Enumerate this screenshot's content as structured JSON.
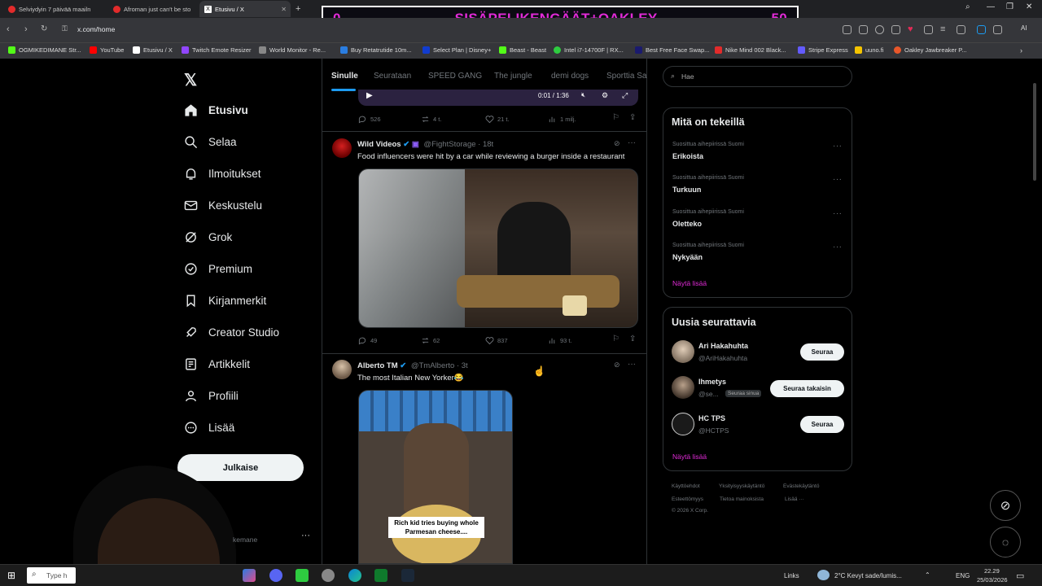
{
  "browser": {
    "tabs": [
      {
        "label": "Selviydyin 7 päivää maailn",
        "color": "#e22b2b"
      },
      {
        "label": "Afroman just can't be sto",
        "color": "#e22b2b"
      },
      {
        "label": "Etusivu / X",
        "color": "#ffffff",
        "active": true
      }
    ],
    "new_tab": "+",
    "url": "x.com/home"
  },
  "overlay": {
    "left_count": "0",
    "title": "SISÄPELIKENGÄÄT+OAKLEY",
    "right_count": "50"
  },
  "bookmarks": [
    {
      "label": "OGMIKEDIMANE Str...",
      "color": "#53fc18"
    },
    {
      "label": "YouTube",
      "color": "#ff0000"
    },
    {
      "label": "Etusivu / X",
      "color": "#ffffff"
    },
    {
      "label": "Twitch Emote Resizer",
      "color": "#9146ff"
    },
    {
      "label": "World Monitor - Re...",
      "color": "#888888"
    },
    {
      "label": "Buy Retatrutide 10m...",
      "color": "#2a7de1"
    },
    {
      "label": "Select Plan | Disney+",
      "color": "#113ccf"
    },
    {
      "label": "Beast - Beast",
      "color": "#53fc18"
    },
    {
      "label": "Intel i7-14700F | RX...",
      "color": "#2ecc40"
    },
    {
      "label": "Best Free Face Swap...",
      "color": "#1a1a6e"
    },
    {
      "label": "Nike Mind 002 Black...",
      "color": "#e22b2b"
    },
    {
      "label": "Stripe Express",
      "color": "#635bff"
    },
    {
      "label": "uuno.fi",
      "color": "#f5c400"
    },
    {
      "label": "Oakley Jawbreaker P...",
      "color": "#e8572a"
    }
  ],
  "sidebar": {
    "items": [
      {
        "label": "Etusivu",
        "icon": "home-icon",
        "bold": true
      },
      {
        "label": "Selaa",
        "icon": "search-icon"
      },
      {
        "label": "Ilmoitukset",
        "icon": "bell-icon"
      },
      {
        "label": "Keskustelu",
        "icon": "mail-icon"
      },
      {
        "label": "Grok",
        "icon": "grok-icon"
      },
      {
        "label": "Premium",
        "icon": "verified-icon"
      },
      {
        "label": "Kirjanmerkit",
        "icon": "bookmark-icon"
      },
      {
        "label": "Creator Studio",
        "icon": "rocket-icon"
      },
      {
        "label": "Artikkelit",
        "icon": "article-icon"
      },
      {
        "label": "Profiili",
        "icon": "person-icon"
      },
      {
        "label": "Lisää",
        "icon": "more-circle-icon"
      }
    ],
    "post_button": "Julkaise",
    "account_handle_fragment": "kemane"
  },
  "feed": {
    "tabs": [
      "Sinulle",
      "Seurataan",
      "SPEED GANG",
      "The jungle",
      "demi dogs",
      "Sporttia Sa"
    ],
    "video_time": "0:01 / 1:36",
    "top_stats": {
      "replies": "526",
      "reposts": "4 t.",
      "likes": "21 t.",
      "views": "1 milj."
    },
    "tweets": [
      {
        "author": "Wild Videos",
        "handle": "@FightStorage · 18t",
        "text": "Food influencers were hit by a car while reviewing a burger inside a restaurant",
        "stats": {
          "replies": "49",
          "reposts": "62",
          "likes": "837",
          "views": "93 t."
        }
      },
      {
        "author": "Alberto TM",
        "handle": "@TmAlberto · 3t",
        "text": "The most Italian New Yorker😂",
        "caption": "Rich kid tries buying whole Parmesan cheese...."
      }
    ]
  },
  "right": {
    "search_placeholder": "Hae",
    "trends_title": "Mitä on tekeillä",
    "trends": [
      {
        "category": "Suosittua aihepiirissä Suomi",
        "name": "Erikoista"
      },
      {
        "category": "Suosittua aihepiirissä Suomi",
        "name": "Turkuun"
      },
      {
        "category": "Suosittua aihepiirissä Suomi",
        "name": "Oletteko"
      },
      {
        "category": "Suosittua aihepiirissä Suomi",
        "name": "Nykyään"
      }
    ],
    "show_more": "Näytä lisää",
    "follow_title": "Uusia seurattavia",
    "follows": [
      {
        "name": "Ari Hakahuhta",
        "handle": "@AriHakahuhta",
        "button": "Seuraa"
      },
      {
        "name": "Ihmetys",
        "handle": "@se...",
        "badge": "Seuraa sinua",
        "button": "Seuraa takaisin"
      },
      {
        "name": "HC TPS",
        "handle": "@HCTPS",
        "button": "Seuraa"
      }
    ],
    "footer": [
      "Käyttöehdot",
      "Yksityisyyskäytäntö",
      "Evästekäytäntö",
      "Esteettömyys",
      "Tietoa mainoksista",
      "Lisää ···",
      "© 2026 X Corp."
    ]
  },
  "taskbar": {
    "search_placeholder": "Type h",
    "links": "Links",
    "weather": "2°C  Kevyt sade/lumis...",
    "lang": "ENG",
    "time": "22.29",
    "date": "25/03/2026"
  },
  "colors": {
    "accent": "#1d9bf0",
    "overlay_text": "#e22bd8",
    "show_more": "#e22bd8"
  }
}
